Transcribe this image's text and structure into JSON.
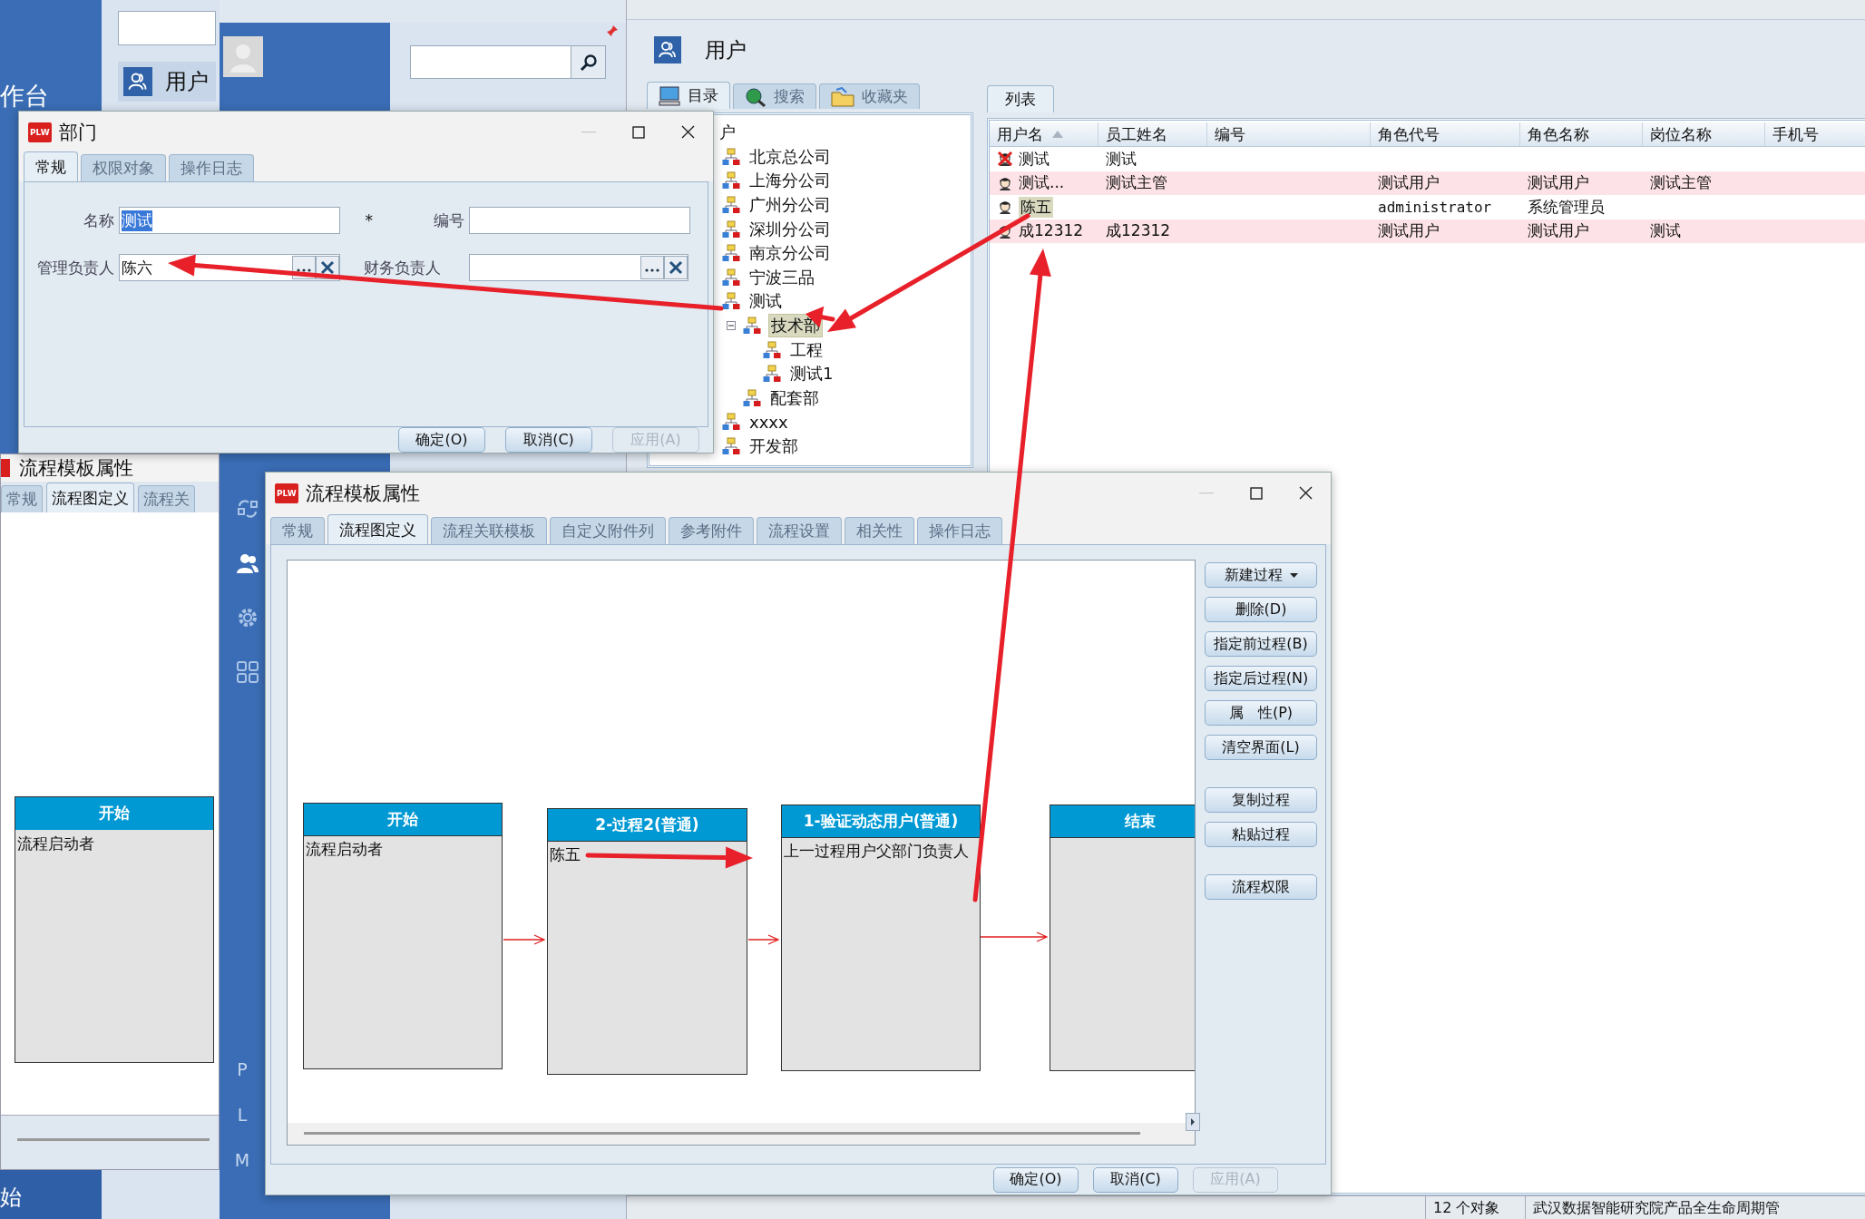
{
  "left_app": {
    "sidebar_items": [
      "作台"
    ],
    "start_label": "始",
    "user_item": "用户",
    "flow_window": {
      "title": "流程模板属性",
      "tabs": [
        {
          "label": "常规",
          "selected": false
        },
        {
          "label": "流程图定义",
          "selected": true
        },
        {
          "label": "流程关",
          "selected": false
        }
      ],
      "node": {
        "title": "开始",
        "body": "流程启动者"
      }
    }
  },
  "middle_app": {
    "nav_icons": [
      {
        "kind": "link",
        "selected": false
      },
      {
        "kind": "users",
        "selected": true
      },
      {
        "kind": "gear",
        "selected": false
      },
      {
        "kind": "grid",
        "selected": false
      }
    ],
    "nav_letters": [
      "P",
      "L",
      "M"
    ]
  },
  "user_window": {
    "title": "用户",
    "nav_tabs": [
      {
        "label": "目录",
        "kind": "directory",
        "selected": true
      },
      {
        "label": "搜索",
        "kind": "search",
        "selected": false
      },
      {
        "label": "收藏夹",
        "kind": "favorites",
        "selected": false
      }
    ],
    "tree": {
      "label": "户",
      "children": [
        {
          "label": "北京总公司",
          "selected": false
        },
        {
          "label": "上海分公司",
          "selected": false
        },
        {
          "label": "广州分公司",
          "selected": false
        },
        {
          "label": "深圳分公司",
          "selected": false
        },
        {
          "label": "南京分公司",
          "selected": false
        },
        {
          "label": "宁波三品",
          "selected": false
        },
        {
          "label": "测试",
          "selected": false,
          "children": [
            {
              "label": "技术部",
              "selected": true,
              "expanded": true,
              "children": [
                {
                  "label": "工程",
                  "selected": false
                },
                {
                  "label": "测试1",
                  "selected": false
                }
              ]
            },
            {
              "label": "配套部",
              "selected": false
            }
          ]
        },
        {
          "label": "xxxx",
          "selected": false
        },
        {
          "label": "开发部",
          "selected": false
        }
      ]
    },
    "list_tab": "列表",
    "columns": [
      {
        "label": "用户名",
        "sorted": true
      },
      {
        "label": "员工姓名",
        "sorted": false
      },
      {
        "label": "编号",
        "sorted": false
      },
      {
        "label": "角色代号",
        "sorted": false
      },
      {
        "label": "角色名称",
        "sorted": false
      },
      {
        "label": "岗位名称",
        "sorted": false
      },
      {
        "label": "手机号",
        "sorted": false
      }
    ],
    "rows": [
      {
        "user_name": "测试",
        "employee_name": "测试",
        "disabled": true,
        "selected": false
      },
      {
        "user_name": "测试...",
        "employee_name": "测试主管",
        "role_code": "测试用户",
        "role_name": "测试用户",
        "position": "测试主管",
        "disabled": false,
        "selected": false
      },
      {
        "user_name": "陈五",
        "role_code": "administrator",
        "role_name": "系统管理员",
        "disabled": false,
        "selected": true
      },
      {
        "user_name": "成12312",
        "employee_name": "成12312",
        "role_code": "测试用户",
        "role_name": "测试用户",
        "position": "测试",
        "disabled": false,
        "selected": false
      }
    ],
    "status_bar": {
      "count": "12 个对象",
      "company": "武汉数据智能研究院产品全生命周期管"
    }
  },
  "department_dialog": {
    "title": "部门",
    "logo": "PLW",
    "tabs": [
      {
        "label": "常规",
        "selected": true
      },
      {
        "label": "权限对象",
        "selected": false
      },
      {
        "label": "操作日志",
        "selected": false
      }
    ],
    "name": {
      "label": "名称",
      "value": "测试",
      "text_selected": true,
      "required_mark": "*"
    },
    "number": {
      "label": "编号"
    },
    "manager": {
      "label": "管理负责人",
      "value": "陈六"
    },
    "finance": {
      "label": "财务负责人"
    },
    "buttons": [
      {
        "label": "确定(O)",
        "disabled": false
      },
      {
        "label": "取消(C)",
        "disabled": false
      },
      {
        "label": "应用(A)",
        "disabled": true
      }
    ]
  },
  "flow_dialog": {
    "title": "流程模板属性",
    "logo": "PLW",
    "tabs": [
      {
        "label": "常规",
        "selected": false
      },
      {
        "label": "流程图定义",
        "selected": true
      },
      {
        "label": "流程关联模板",
        "selected": false
      },
      {
        "label": "自定义附件列",
        "selected": false
      },
      {
        "label": "参考附件",
        "selected": false
      },
      {
        "label": "流程设置",
        "selected": false
      },
      {
        "label": "相关性",
        "selected": false
      },
      {
        "label": "操作日志",
        "selected": false
      }
    ],
    "nodes": [
      {
        "title": "开始",
        "body": "流程启动者"
      },
      {
        "title": "2-过程2(普通)",
        "body": "陈五"
      },
      {
        "title": "1-验证动态用户(普通)",
        "body": "上一过程用户父部门负责人"
      },
      {
        "title": "结束"
      }
    ],
    "button_groups": [
      [
        {
          "label": "新建过程",
          "kind": "dropdown"
        },
        {
          "label": "删除(D)",
          "kind": "plain"
        },
        {
          "label": "指定前过程(B)",
          "kind": "plain"
        },
        {
          "label": "指定后过程(N)",
          "kind": "plain"
        },
        {
          "label": "属　性(P)",
          "kind": "plain"
        },
        {
          "label": "清空界面(L)",
          "kind": "plain"
        }
      ],
      [
        {
          "label": "复制过程",
          "kind": "plain"
        },
        {
          "label": "粘贴过程",
          "kind": "plain"
        }
      ],
      [
        {
          "label": "流程权限",
          "kind": "plain"
        }
      ]
    ],
    "buttons": [
      {
        "label": "确定(O)",
        "disabled": false
      },
      {
        "label": "取消(C)",
        "disabled": false
      },
      {
        "label": "应用(A)",
        "disabled": true
      }
    ]
  }
}
